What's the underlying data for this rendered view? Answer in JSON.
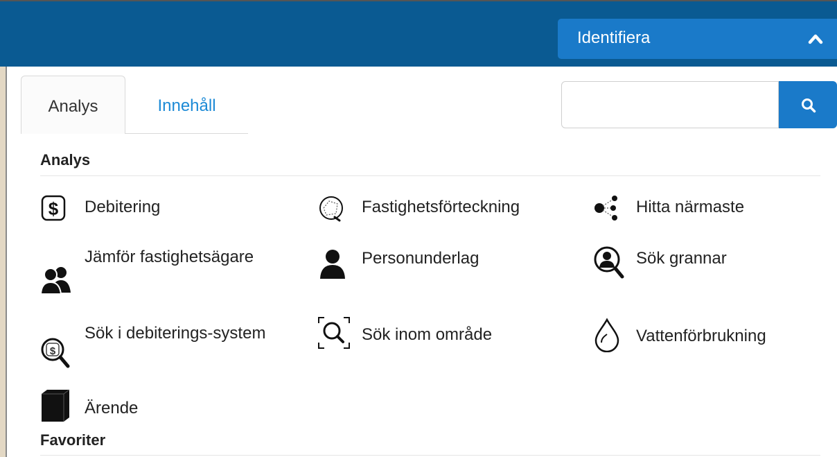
{
  "header": {
    "identify_label": "Identifiera",
    "identify_chevron": "chevron-up-icon",
    "accent_color": "#0a5a92",
    "button_color": "#1a7ac9"
  },
  "tabs": [
    {
      "label": "Analys",
      "active": true
    },
    {
      "label": "Innehåll",
      "active": false
    }
  ],
  "search": {
    "value": "",
    "placeholder": "",
    "icon": "search-icon"
  },
  "sections": {
    "analys_title": "Analys",
    "favoriter_title": "Favoriter"
  },
  "tools": [
    {
      "label": "Debitering",
      "icon": "dollar-icon"
    },
    {
      "label": "Fastighetsförteckning",
      "icon": "property-list-icon"
    },
    {
      "label": "Hitta närmaste",
      "icon": "nearest-icon"
    },
    {
      "label": "Jämför fastighetsägare",
      "icon": "users-icon"
    },
    {
      "label": "Personunderlag",
      "icon": "person-icon"
    },
    {
      "label": "Sök grannar",
      "icon": "search-person-icon"
    },
    {
      "label": "Sök i debiterings-system",
      "icon": "search-dollar-icon"
    },
    {
      "label": "Sök inom område",
      "icon": "search-area-icon"
    },
    {
      "label": "Vattenförbrukning",
      "icon": "water-drop-icon"
    },
    {
      "label": "Ärende",
      "icon": "case-box-icon"
    }
  ]
}
